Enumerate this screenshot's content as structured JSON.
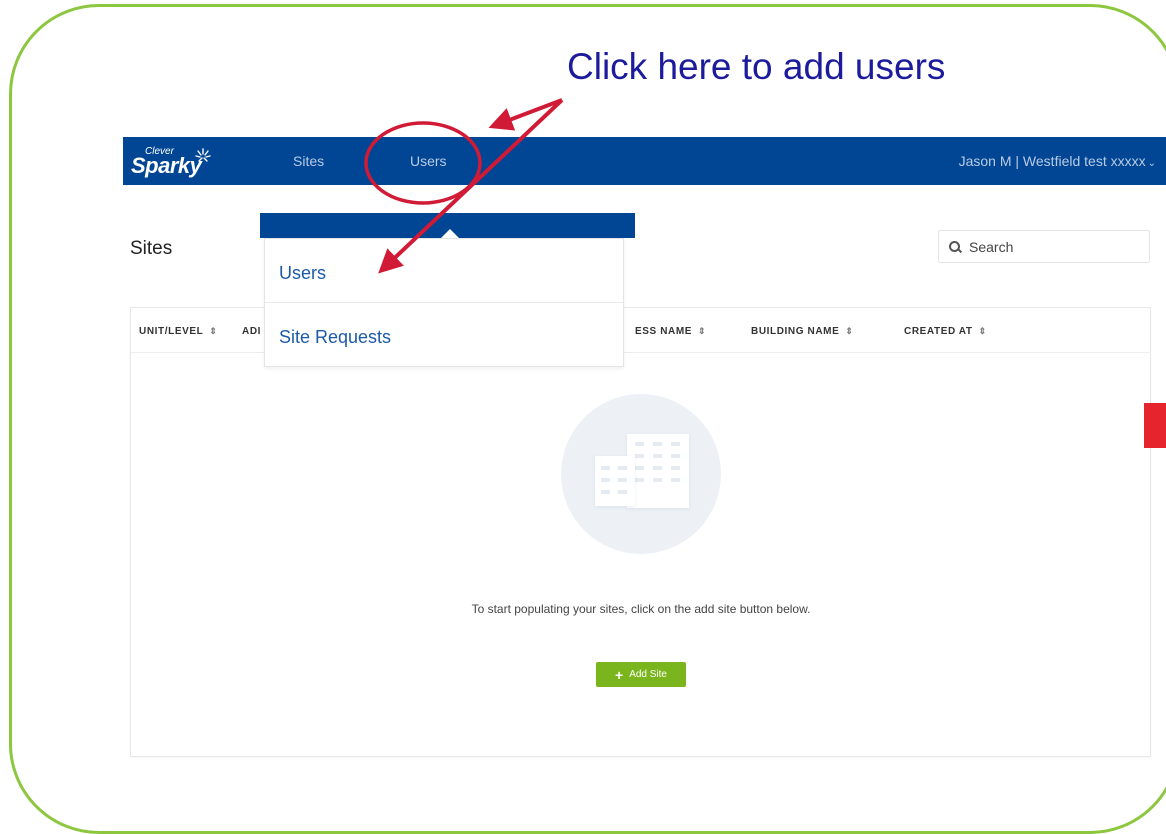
{
  "annotation": {
    "callout_text": "Click here to add users"
  },
  "app": {
    "logo_small": "Clever",
    "logo_big": "Sparky"
  },
  "navbar": {
    "items": [
      {
        "label": "Sites"
      },
      {
        "label": "Users"
      }
    ],
    "user_label": "Jason M | Westfield test xxxxx"
  },
  "page": {
    "title": "Sites",
    "search": {
      "placeholder": "Search"
    }
  },
  "table": {
    "columns": [
      {
        "label": "UNIT/LEVEL"
      },
      {
        "label": "ADI"
      },
      {
        "label": "ESS NAME"
      },
      {
        "label": "BUILDING NAME"
      },
      {
        "label": "CREATED AT"
      }
    ]
  },
  "empty_state": {
    "message": "To start populating your sites, click on the add site button below.",
    "button_label": "Add Site"
  },
  "dropdown": {
    "items": [
      {
        "label": "Users"
      },
      {
        "label": "Site Requests"
      }
    ]
  },
  "colors": {
    "navbar": "#014694",
    "frame": "#8dc63f",
    "annotation_arrow": "#d11a36",
    "add_button": "#7ab51d",
    "callout": "#1b1b9b"
  }
}
